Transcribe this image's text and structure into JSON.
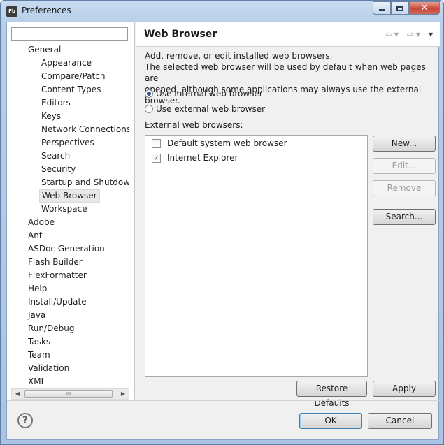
{
  "window": {
    "title": "Preferences",
    "icon_text": "Fb",
    "close_glyph": "✕"
  },
  "filter": {
    "value": "",
    "placeholder": ""
  },
  "tree": [
    {
      "label": "General",
      "level": 0
    },
    {
      "label": "Appearance",
      "level": 1
    },
    {
      "label": "Compare/Patch",
      "level": 1
    },
    {
      "label": "Content Types",
      "level": 1
    },
    {
      "label": "Editors",
      "level": 1
    },
    {
      "label": "Keys",
      "level": 1
    },
    {
      "label": "Network Connections",
      "level": 1
    },
    {
      "label": "Perspectives",
      "level": 1
    },
    {
      "label": "Search",
      "level": 1
    },
    {
      "label": "Security",
      "level": 1
    },
    {
      "label": "Startup and Shutdowr",
      "level": 1
    },
    {
      "label": "Web Browser",
      "level": 1,
      "selected": true
    },
    {
      "label": "Workspace",
      "level": 1
    },
    {
      "label": "Adobe",
      "level": 0
    },
    {
      "label": "Ant",
      "level": 0
    },
    {
      "label": "ASDoc Generation",
      "level": 0
    },
    {
      "label": "Flash Builder",
      "level": 0
    },
    {
      "label": "FlexFormatter",
      "level": 0
    },
    {
      "label": "Help",
      "level": 0
    },
    {
      "label": "Install/Update",
      "level": 0
    },
    {
      "label": "Java",
      "level": 0
    },
    {
      "label": "Run/Debug",
      "level": 0
    },
    {
      "label": "Tasks",
      "level": 0
    },
    {
      "label": "Team",
      "level": 0
    },
    {
      "label": "Validation",
      "level": 0
    },
    {
      "label": "XML",
      "level": 0
    }
  ],
  "scrollbar": {
    "left_glyph": "◀",
    "right_glyph": "▶",
    "thumb_grip": "III"
  },
  "page": {
    "title": "Web Browser",
    "nav": {
      "back": "⇦",
      "forward": "⇨",
      "dropdown": "▾",
      "menu": "▾"
    },
    "description_lines": [
      "Add, remove, or edit installed web browsers.",
      "The selected web browser will be used by default when web pages are",
      "opened, although some applications may always use the external browser."
    ],
    "radio_internal": "Use internal web browser",
    "radio_external": "Use external web browser",
    "radio_selected": "internal",
    "external_label": "External web browsers:",
    "browsers": [
      {
        "name": "Default system web browser",
        "checked": false
      },
      {
        "name": "Internet Explorer",
        "checked": true
      }
    ],
    "buttons": {
      "new": "New...",
      "edit": "Edit...",
      "remove": "Remove",
      "search": "Search...",
      "restore_defaults": "Restore Defaults",
      "apply": "Apply"
    },
    "check_glyph": "✓"
  },
  "footer": {
    "help_glyph": "?",
    "ok": "OK",
    "cancel": "Cancel"
  }
}
